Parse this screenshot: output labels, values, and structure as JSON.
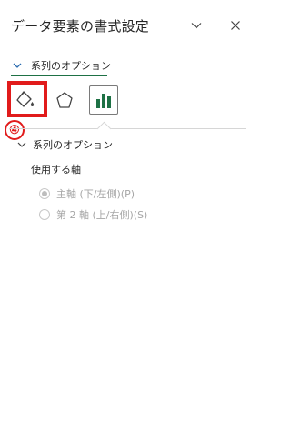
{
  "pane": {
    "title": "データ要素の書式設定",
    "options_icon": "chevron-down-icon",
    "close_icon": "close-icon"
  },
  "series_tab": {
    "label": "系列のオプション",
    "chevron_icon": "chevron-down-icon"
  },
  "icon_tabs": [
    {
      "name": "fill-line",
      "icon": "paint-bucket-icon",
      "selected": false
    },
    {
      "name": "effects",
      "icon": "pentagon-icon",
      "selected": false
    },
    {
      "name": "series-options",
      "icon": "bar-chart-icon",
      "selected": true
    }
  ],
  "annotation": {
    "step": "④",
    "color": "#e11b1b"
  },
  "section": {
    "title": "系列のオプション",
    "axis_label": "使用する軸",
    "radios": [
      {
        "label": "主軸 (下/左側)(P)",
        "checked": true,
        "disabled": true
      },
      {
        "label": "第 2 軸 (上/右側)(S)",
        "checked": false,
        "disabled": true
      }
    ]
  },
  "colors": {
    "accent": "#1e7145",
    "annotation": "#e11b1b",
    "disabled_text": "#a6a6a6"
  }
}
